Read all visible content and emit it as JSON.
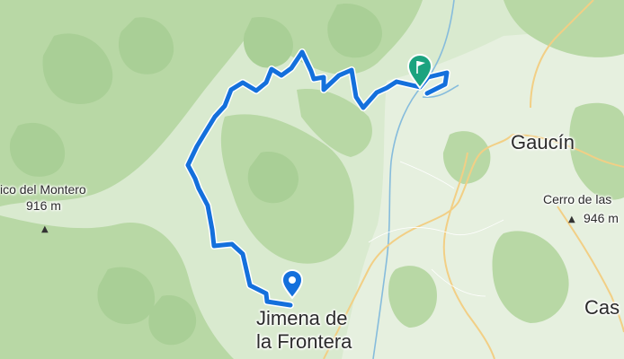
{
  "map": {
    "route_color": "#0f6ad8",
    "start_marker_color": "#0f6ad8",
    "end_marker_color": "#1ba37f",
    "forest_color": "#b7d7a4",
    "background_color": "#dcebd2",
    "river_color": "#7fb7d8",
    "road_color": "#f1c979"
  },
  "places": {
    "jimena_line1": "Jimena de",
    "jimena_line2": "la Frontera",
    "gaucin": "Gaucín",
    "casares_partial": "Cas"
  },
  "peaks": {
    "montero_name": "ico del Montero",
    "montero_elev": "916 m",
    "cerro_name": "Cerro de las",
    "cerro_elev": "946 m"
  },
  "icons": {
    "peak_glyph": "▲"
  }
}
